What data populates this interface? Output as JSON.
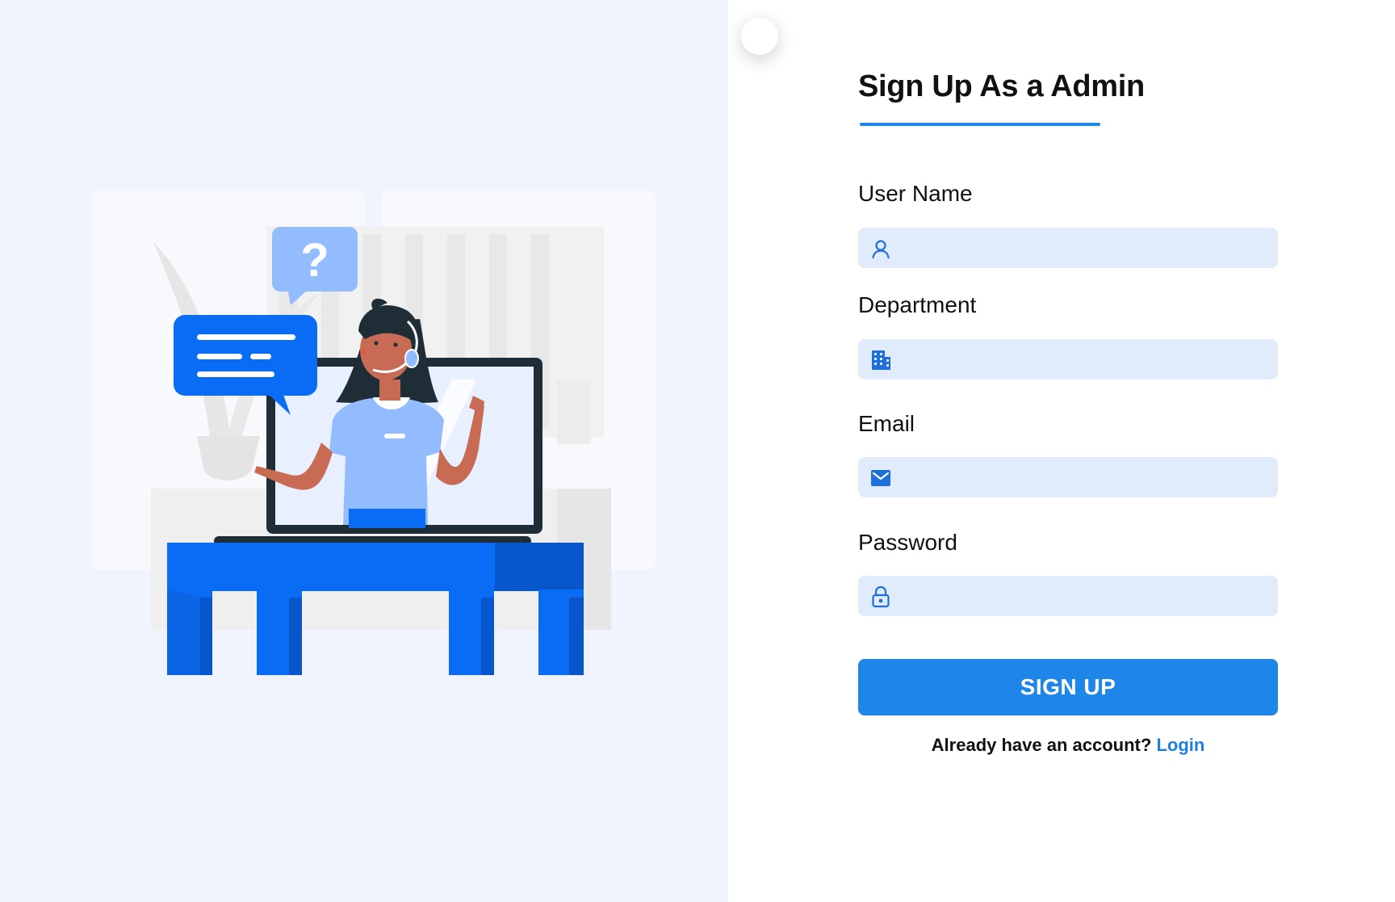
{
  "form": {
    "title": "Sign Up As a Admin",
    "fields": {
      "username": {
        "label": "User Name",
        "icon": "user-icon",
        "value": "",
        "placeholder": ""
      },
      "department": {
        "label": "Department",
        "icon": "building-icon",
        "value": "",
        "placeholder": ""
      },
      "email": {
        "label": "Email",
        "icon": "mail-icon",
        "value": "",
        "placeholder": ""
      },
      "password": {
        "label": "Password",
        "icon": "lock-icon",
        "value": "",
        "placeholder": ""
      }
    },
    "submit_label": "SIGN UP",
    "login_prompt": "Already have an account?",
    "login_link": "Login"
  },
  "colors": {
    "accent": "#1e86e8",
    "link": "#1e7fe0",
    "field_bg": "#e0ecfb",
    "left_bg": "#eff4fe",
    "desk": "#0a6cf5",
    "desk_dark": "#0856cc",
    "bubble_light": "#93bcff"
  }
}
